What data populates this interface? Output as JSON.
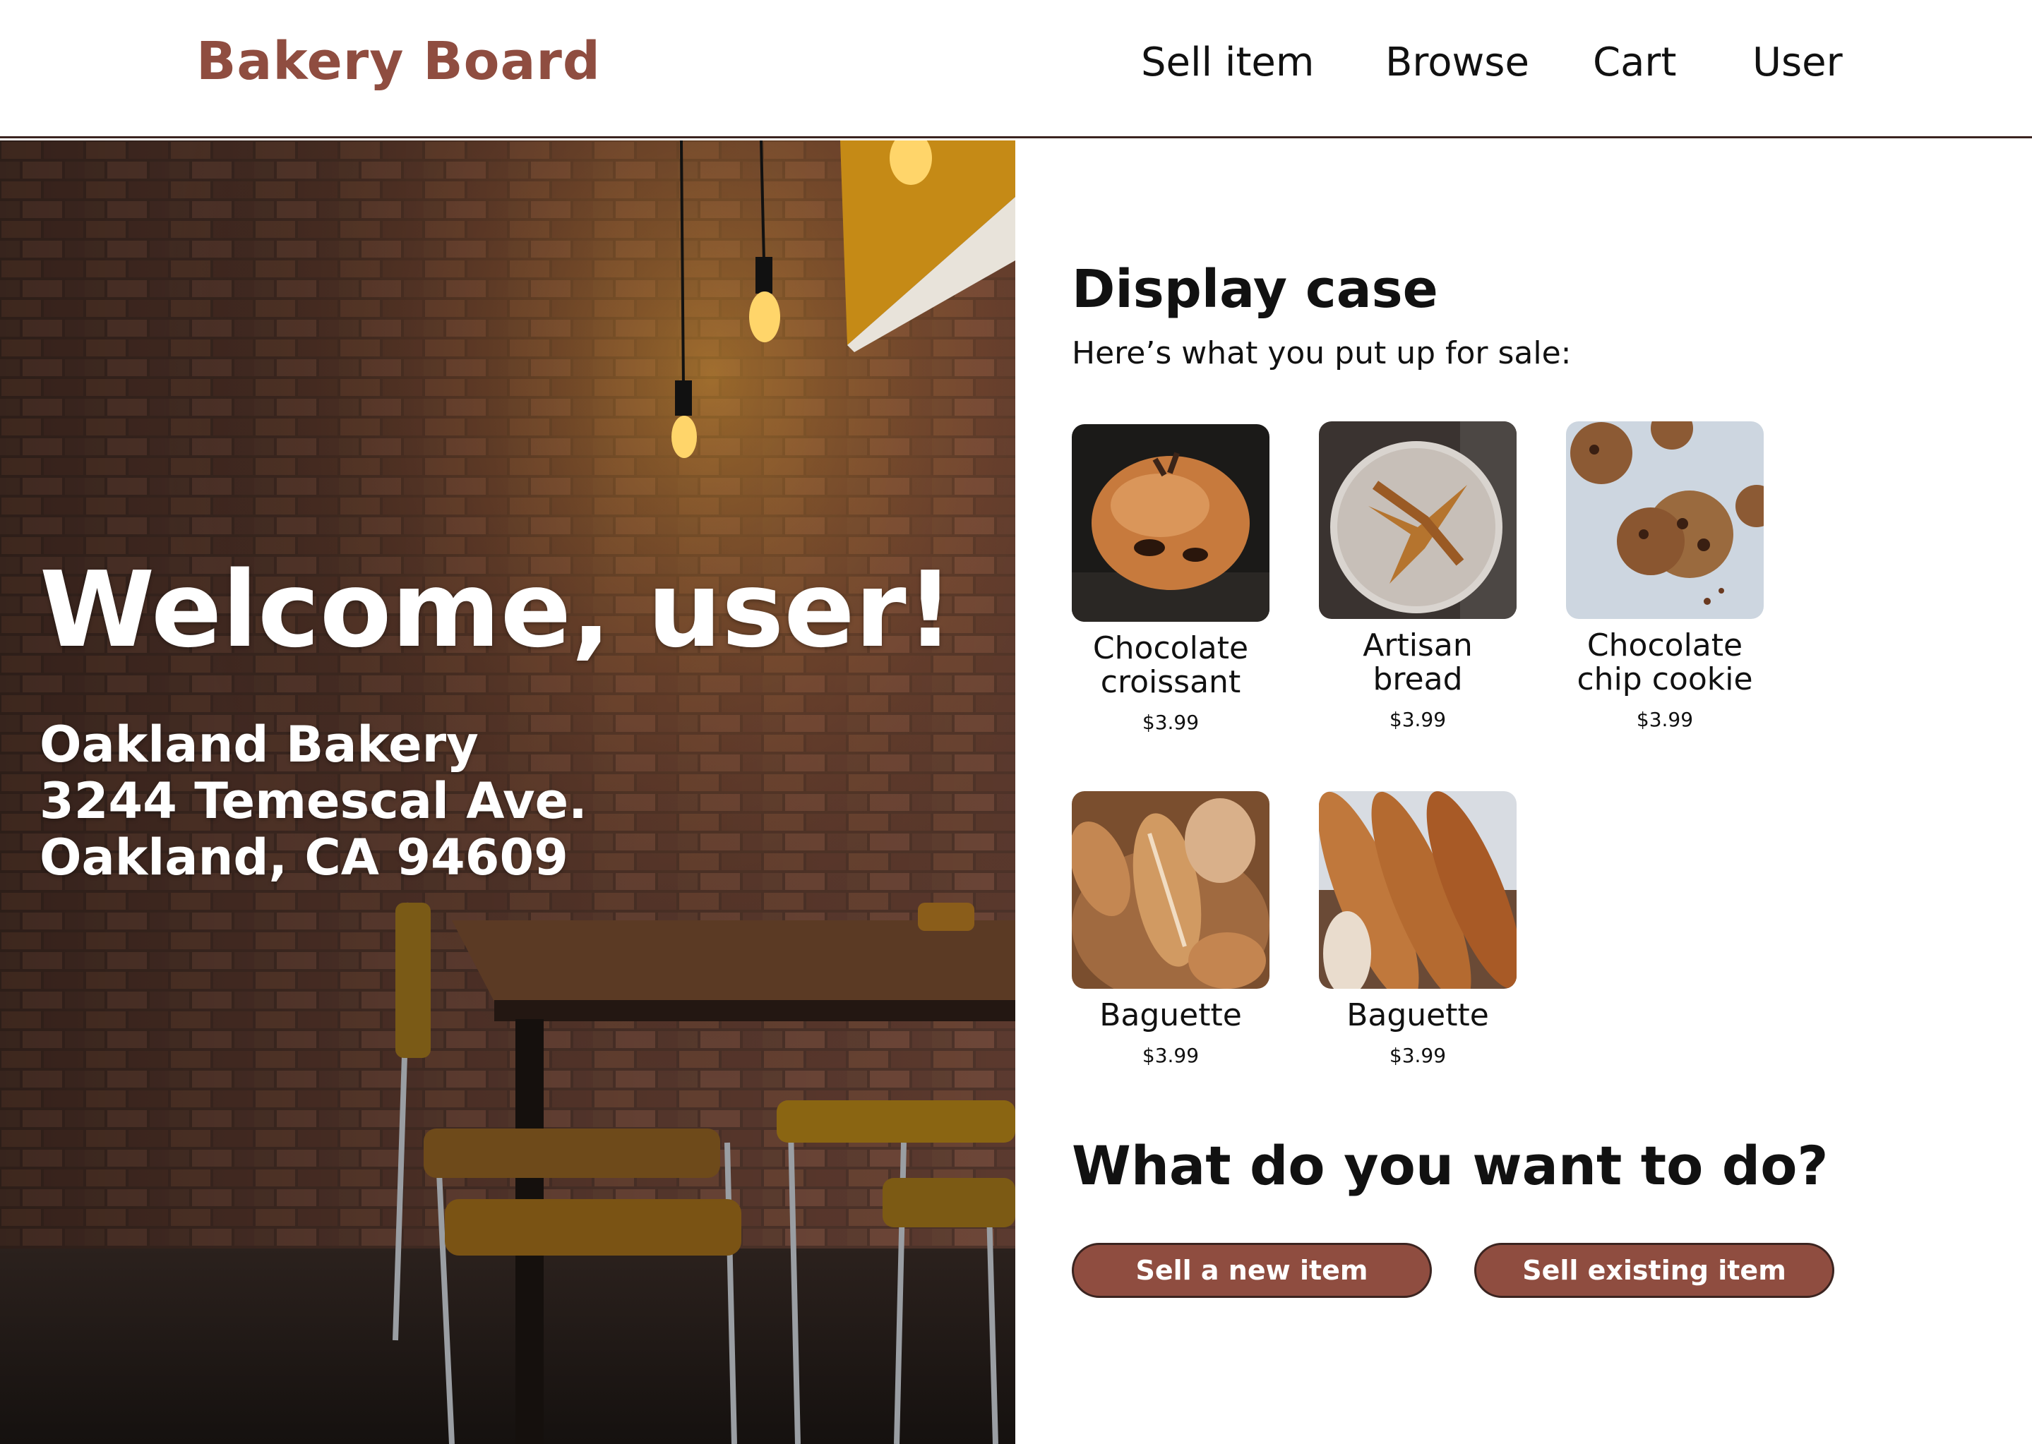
{
  "header": {
    "brand": "Bakery Board",
    "nav": [
      "Sell item",
      "Browse",
      "Cart",
      "User"
    ]
  },
  "hero": {
    "welcome": "Welcome, user!",
    "bakery": {
      "name": "Oakland Bakery",
      "street": "3244 Temescal Ave.",
      "city": "Oakland, CA 94609"
    }
  },
  "display_case": {
    "title": "Display case",
    "subtitle": "Here’s what you put up for sale:",
    "items": [
      {
        "name_line1": "Chocolate",
        "name_line2": "croissant",
        "price": "$3.99",
        "image": "croissant-photo"
      },
      {
        "name_line1": "Artisan",
        "name_line2": "bread",
        "price": "$3.99",
        "image": "bread-loaf-photo"
      },
      {
        "name_line1": "Chocolate",
        "name_line2": "chip cookie",
        "price": "$3.99",
        "image": "cookies-photo"
      },
      {
        "name_line1": "Baguette",
        "name_line2": "",
        "price": "$3.99",
        "image": "bread-basket-photo"
      },
      {
        "name_line1": "Baguette",
        "name_line2": "",
        "price": "$3.99",
        "image": "baguettes-photo"
      }
    ]
  },
  "actions": {
    "title": "What do you want to do?",
    "sell_new": "Sell a new item",
    "sell_existing": "Sell existing item"
  },
  "colors": {
    "brand": "#8f4d40",
    "button_border": "#3b2420",
    "text": "#111111"
  }
}
